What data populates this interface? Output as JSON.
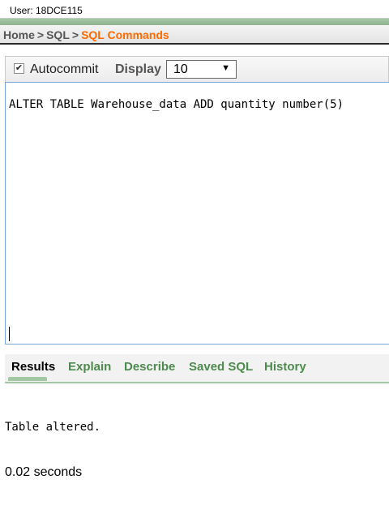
{
  "user": {
    "label": "User: 18DCE115"
  },
  "breadcrumb": {
    "home": "Home",
    "sep": ">",
    "sql": "SQL",
    "current": "SQL Commands"
  },
  "controls": {
    "autocommit_checked": true,
    "autocommit_label": "Autocommit",
    "display_label": "Display",
    "display_value": "10"
  },
  "editor": {
    "sql": "ALTER TABLE Warehouse_data ADD quantity number(5)"
  },
  "tabs": [
    {
      "label": "Results",
      "active": true
    },
    {
      "label": "Explain",
      "active": false
    },
    {
      "label": "Describe",
      "active": false
    },
    {
      "label": "Saved SQL",
      "active": false
    },
    {
      "label": "History",
      "active": false
    }
  ],
  "results": {
    "message": "Table altered.",
    "time": "0.02 seconds"
  },
  "colors": {
    "accent": "#ff6a00",
    "tab_green": "#4d8a4d",
    "bar_green": "#a4c7a4"
  }
}
